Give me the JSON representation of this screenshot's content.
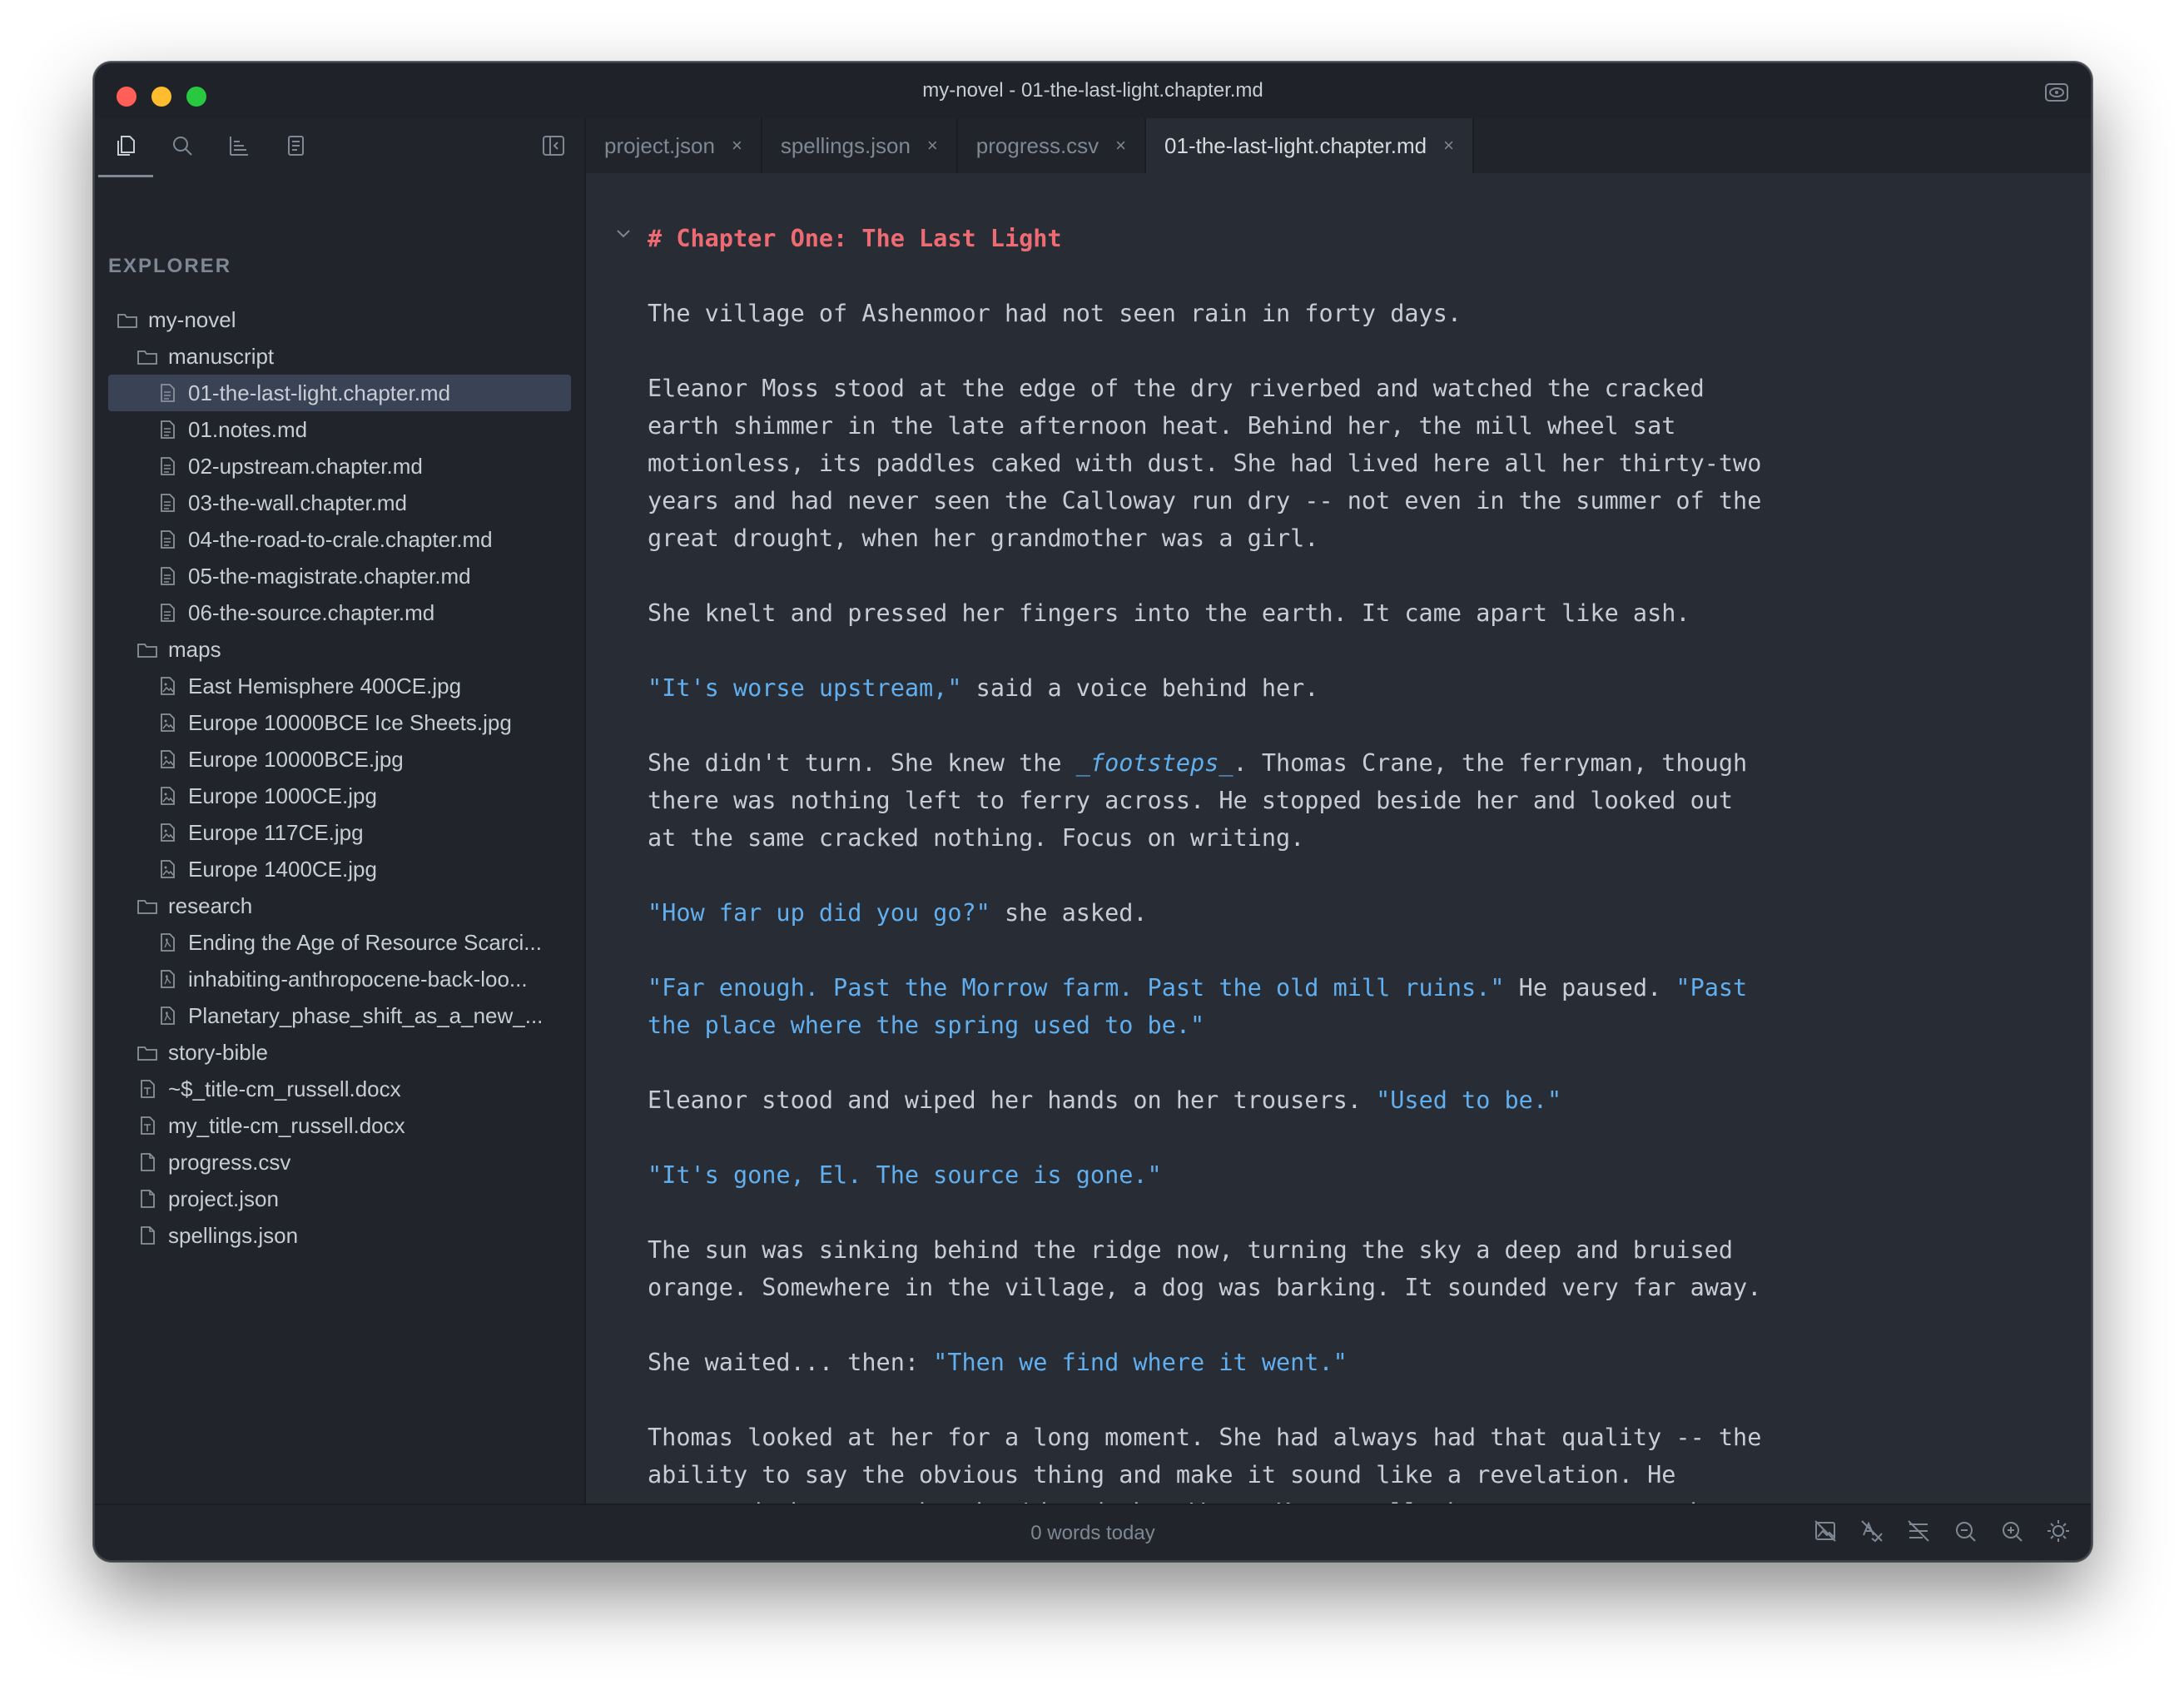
{
  "window": {
    "title": "my-novel - 01-the-last-light.chapter.md"
  },
  "sidebar": {
    "heading": "EXPLORER",
    "tree": [
      {
        "label": "my-novel",
        "type": "folder",
        "depth": 0
      },
      {
        "label": "manuscript",
        "type": "folder",
        "depth": 1
      },
      {
        "label": "01-the-last-light.chapter.md",
        "type": "file",
        "depth": 2,
        "selected": true
      },
      {
        "label": "01.notes.md",
        "type": "file",
        "depth": 2
      },
      {
        "label": "02-upstream.chapter.md",
        "type": "file",
        "depth": 2
      },
      {
        "label": "03-the-wall.chapter.md",
        "type": "file",
        "depth": 2
      },
      {
        "label": "04-the-road-to-crale.chapter.md",
        "type": "file",
        "depth": 2
      },
      {
        "label": "05-the-magistrate.chapter.md",
        "type": "file",
        "depth": 2
      },
      {
        "label": "06-the-source.chapter.md",
        "type": "file",
        "depth": 2
      },
      {
        "label": "maps",
        "type": "folder",
        "depth": 1
      },
      {
        "label": "East Hemisphere 400CE.jpg",
        "type": "image",
        "depth": 2
      },
      {
        "label": "Europe 10000BCE Ice Sheets.jpg",
        "type": "image",
        "depth": 2
      },
      {
        "label": "Europe 10000BCE.jpg",
        "type": "image",
        "depth": 2
      },
      {
        "label": "Europe 1000CE.jpg",
        "type": "image",
        "depth": 2
      },
      {
        "label": "Europe 117CE.jpg",
        "type": "image",
        "depth": 2
      },
      {
        "label": "Europe 1400CE.jpg",
        "type": "image",
        "depth": 2
      },
      {
        "label": "research",
        "type": "folder",
        "depth": 1
      },
      {
        "label": "Ending the Age of Resource Scarci...",
        "type": "pdf",
        "depth": 2
      },
      {
        "label": "inhabiting-anthropocene-back-loo...",
        "type": "pdf",
        "depth": 2
      },
      {
        "label": "Planetary_phase_shift_as_a_new_...",
        "type": "pdf",
        "depth": 2
      },
      {
        "label": "story-bible",
        "type": "folder",
        "depth": 1
      },
      {
        "label": "~$_title-cm_russell.docx",
        "type": "doc",
        "depth": 1
      },
      {
        "label": "my_title-cm_russell.docx",
        "type": "doc",
        "depth": 1
      },
      {
        "label": "progress.csv",
        "type": "plain",
        "depth": 1
      },
      {
        "label": "project.json",
        "type": "plain",
        "depth": 1
      },
      {
        "label": "spellings.json",
        "type": "plain",
        "depth": 1
      }
    ]
  },
  "tabs": [
    {
      "label": "project.json",
      "active": false
    },
    {
      "label": "spellings.json",
      "active": false
    },
    {
      "label": "progress.csv",
      "active": false
    },
    {
      "label": "01-the-last-light.chapter.md",
      "active": true
    }
  ],
  "tab_close_glyph": "×",
  "editor": {
    "paragraphs": [
      [
        {
          "t": "# Chapter One: The Last Light",
          "s": "heading"
        }
      ],
      [
        {
          "t": "The village of Ashenmoor had not seen rain in forty days."
        }
      ],
      [
        {
          "t": "Eleanor Moss stood at the edge of the dry riverbed and watched the cracked\nearth shimmer in the late afternoon heat. Behind her, the mill wheel sat\nmotionless, its paddles caked with dust. She had lived here all her thirty-two\nyears and had never seen the Calloway run dry -- not even in the summer of the\ngreat drought, when her grandmother was a girl."
        }
      ],
      [
        {
          "t": "She knelt and pressed her fingers into the earth. It came apart like ash."
        }
      ],
      [
        {
          "t": "\"It's worse upstream,\"",
          "s": "quote"
        },
        {
          "t": " said a voice behind her."
        }
      ],
      [
        {
          "t": "She didn't turn. She knew the "
        },
        {
          "t": "_footsteps_",
          "s": "italic"
        },
        {
          "t": ". Thomas Crane, the ferryman, though\nthere was nothing left to ferry across. He stopped beside her and looked out\nat the same cracked nothing. Focus on writing."
        }
      ],
      [
        {
          "t": "\"How far up did you go?\"",
          "s": "quote"
        },
        {
          "t": " she asked."
        }
      ],
      [
        {
          "t": "\"Far enough. Past the Morrow farm. Past the old mill ruins.\"",
          "s": "quote"
        },
        {
          "t": " He paused. "
        },
        {
          "t": "\"Past\nthe place where the spring used to be.\"",
          "s": "quote"
        }
      ],
      [
        {
          "t": "Eleanor stood and wiped her hands on her trousers. "
        },
        {
          "t": "\"Used to be.\"",
          "s": "quote"
        }
      ],
      [
        {
          "t": "\"It's gone, El. The source is gone.\"",
          "s": "quote"
        }
      ],
      [
        {
          "t": "The sun was sinking behind the ridge now, turning the sky a deep and bruised\norange. Somewhere in the village, a dog was barking. It sounded very far away."
        }
      ],
      [
        {
          "t": "She waited... then: "
        },
        {
          "t": "\"Then we find where it went.\"",
          "s": "quote"
        }
      ],
      [
        {
          "t": "Thomas looked at her for a long moment. She had always had that quality -- the\nability to say the obvious thing and make it sound like a revelation. He\nsupposed that was why they'd made her Water Keeper all those years ago, when"
        }
      ]
    ]
  },
  "status": {
    "words_today": "0 words today",
    "icons": [
      "image-off-icon",
      "spellcheck-off-icon",
      "strikethrough-icon",
      "zoom-out-icon",
      "zoom-in-icon",
      "theme-brightness-icon"
    ]
  },
  "colors": {
    "background": "#282c34",
    "sidebar": "#21252b",
    "heading": "#ef6b73",
    "dialogue": "#61afef",
    "text": "#c8ccd4",
    "muted": "#7f8794",
    "selection": "#3a4356"
  }
}
